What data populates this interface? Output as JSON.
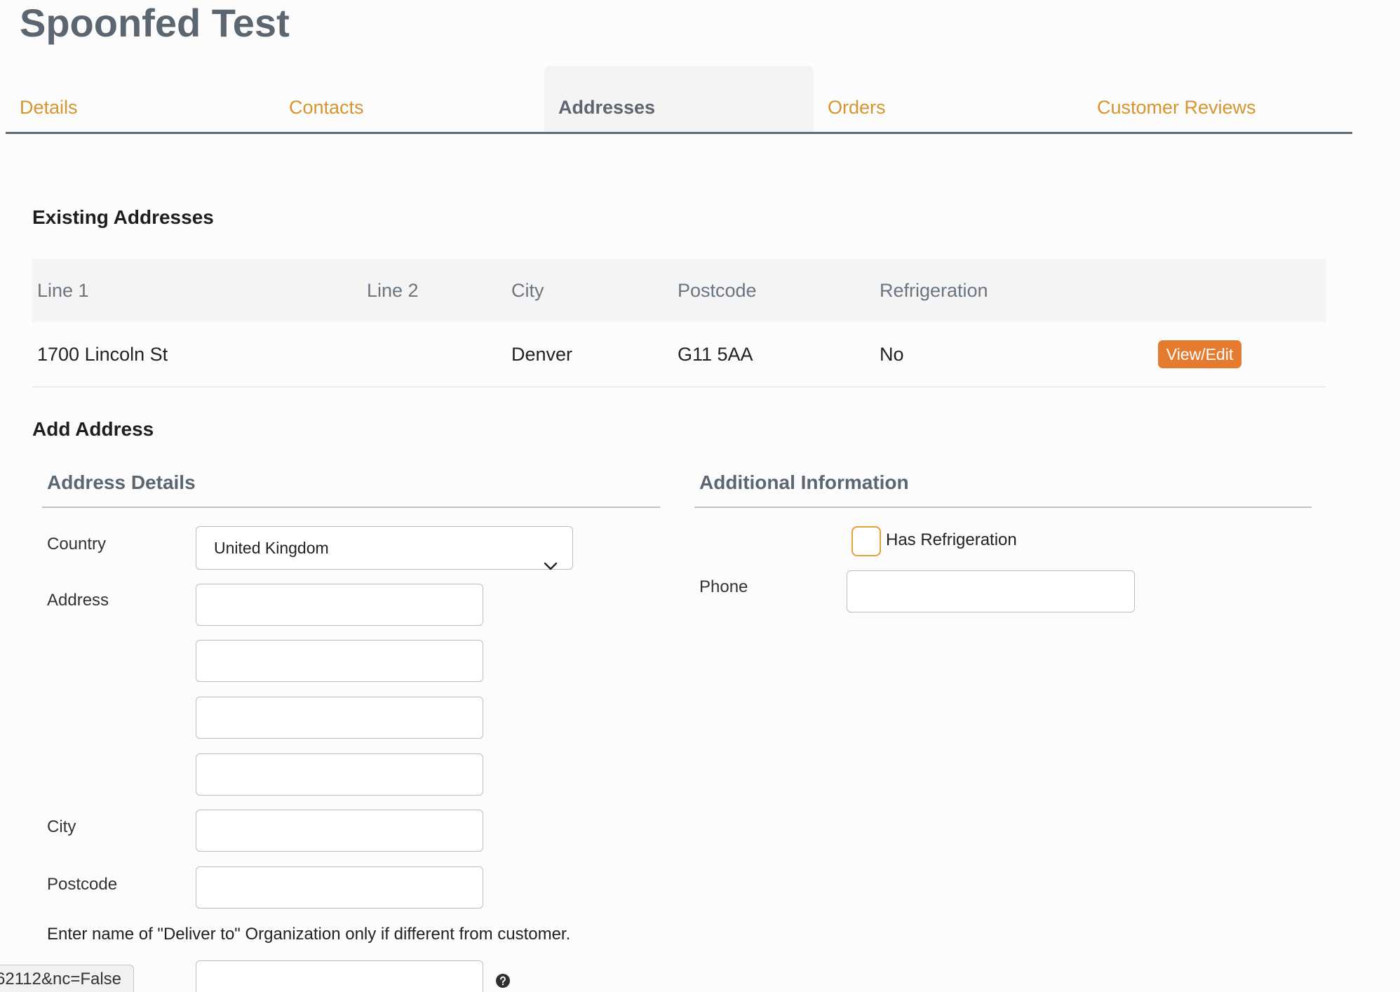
{
  "page": {
    "title": "Spoonfed Test"
  },
  "tabs": [
    {
      "label": "Details",
      "active": false
    },
    {
      "label": "Contacts",
      "active": false
    },
    {
      "label": "Addresses",
      "active": true
    },
    {
      "label": "Orders",
      "active": false
    },
    {
      "label": "Customer Reviews",
      "active": false
    }
  ],
  "existing_addresses": {
    "heading": "Existing Addresses",
    "columns": [
      "Line 1",
      "Line 2",
      "City",
      "Postcode",
      "Refrigeration"
    ],
    "rows": [
      {
        "line1": "1700 Lincoln St",
        "line2": "",
        "city": "Denver",
        "postcode": "G11 5AA",
        "refrigeration": "No",
        "action_label": "View/Edit"
      }
    ]
  },
  "add_address": {
    "heading": "Add Address",
    "address_details": {
      "heading": "Address Details",
      "country_label": "Country",
      "country_value": "United Kingdom",
      "address_label": "Address",
      "address_lines": [
        "",
        "",
        "",
        ""
      ],
      "city_label": "City",
      "city_value": "",
      "postcode_label": "Postcode",
      "postcode_value": "",
      "deliver_to_help": "Enter name of \"Deliver to\" Organization only if different from customer.",
      "deliver_to_value": ""
    },
    "additional_information": {
      "heading": "Additional Information",
      "has_refrigeration_label": "Has Refrigeration",
      "has_refrigeration_checked": false,
      "phone_label": "Phone",
      "phone_value": ""
    }
  },
  "status_bar": {
    "url_text": "62112&nc=False"
  },
  "icons": {
    "country_select": "chevron-down-icon",
    "deliver_to_help": "help-icon"
  },
  "colors": {
    "title_text": "#5b6670",
    "tab_link": "#d6952f",
    "tab_underline": "#5f6b76",
    "button_bg": "#e57b2f",
    "checkbox_border": "#e3a03d"
  }
}
